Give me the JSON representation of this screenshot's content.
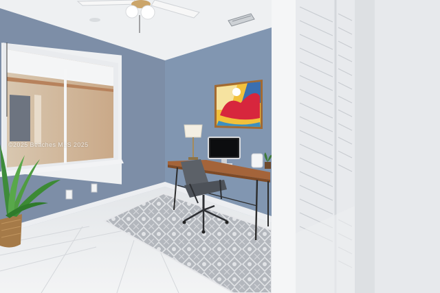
{
  "photo": {
    "watermark": "©2025 Beaches MLS 2025"
  },
  "palette": {
    "ceiling": "#eef0f2",
    "wall_left": "#7d8ea7",
    "wall_back": "#8196b1",
    "floor_tile": "#eef0f1",
    "rug": "#b9bcc2",
    "desk_wood": "#a4643a",
    "chair": "#5c6168",
    "shutter": "#f1f2f4",
    "art_yellow": "#f2c13c",
    "art_red": "#d7263d",
    "art_blue": "#3a6fb0"
  },
  "icons": [
    "ceiling-fan-icon",
    "vent-icon",
    "window-icon",
    "lamp-icon",
    "monitor-icon",
    "plant-icon",
    "outlet-icon"
  ]
}
